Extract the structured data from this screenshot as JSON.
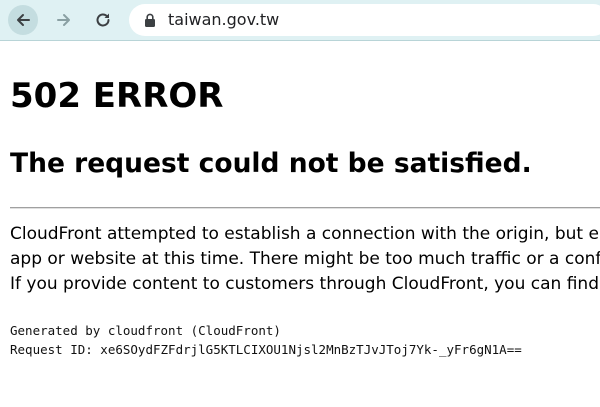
{
  "browser": {
    "url": "taiwan.gov.tw",
    "icons": {
      "back": "arrow-left-icon",
      "forward": "arrow-right-icon",
      "reload": "reload-icon",
      "lock": "lock-icon"
    },
    "colors": {
      "toolbar_bg": "#dff1f3",
      "omnibox_bg": "#ffffff"
    }
  },
  "page": {
    "title": "502 ERROR",
    "subtitle": "The request could not be satisfied.",
    "message_lines": [
      "CloudFront attempted to establish a connection with the origin, but either the attempt failed or the origin closed the connection. We can't connect to the server for this",
      "app or website at this time. There might be too much traffic or a configuration error. Try again later, or contact the app or website owner.",
      "If you provide content to customers through CloudFront, you can find steps to troubleshoot and help prevent this error by reviewing the CloudFront documentation."
    ],
    "generated_by": "Generated by cloudfront (CloudFront)",
    "request_id": "Request ID: xe6SOydFZFdrjlG5KTLCIXOU1Njsl2MnBzTJvJToj7Yk-_yFr6gN1A=="
  }
}
